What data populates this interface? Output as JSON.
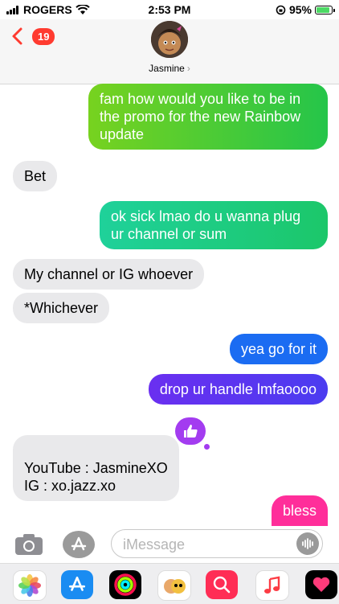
{
  "status": {
    "carrier": "ROGERS",
    "time": "2:53 PM",
    "battery": "95%"
  },
  "nav": {
    "back_count": "19",
    "contact_name": "Jasmine",
    "chevron": "›"
  },
  "messages": [
    {
      "from": "me",
      "text": "fam how would you like to be in the promo for the new Rainbow update"
    },
    {
      "from": "them",
      "text": "Bet"
    },
    {
      "from": "me",
      "text": "ok sick lmao do u wanna plug ur channel or sum"
    },
    {
      "from": "them",
      "text": "My channel or IG whoever"
    },
    {
      "from": "them",
      "text": "*Whichever"
    },
    {
      "from": "me",
      "text": "yea go for it"
    },
    {
      "from": "me",
      "text": "drop ur handle lmfaoooo"
    },
    {
      "from": "them",
      "text": "YouTube : JasmineXO\nIG : xo.jazz.xo"
    },
    {
      "from": "me",
      "text": "bless"
    }
  ],
  "composer": {
    "placeholder": "iMessage"
  },
  "colors": {
    "accent": "#ff3b30",
    "reaction": "#a33cf0"
  }
}
